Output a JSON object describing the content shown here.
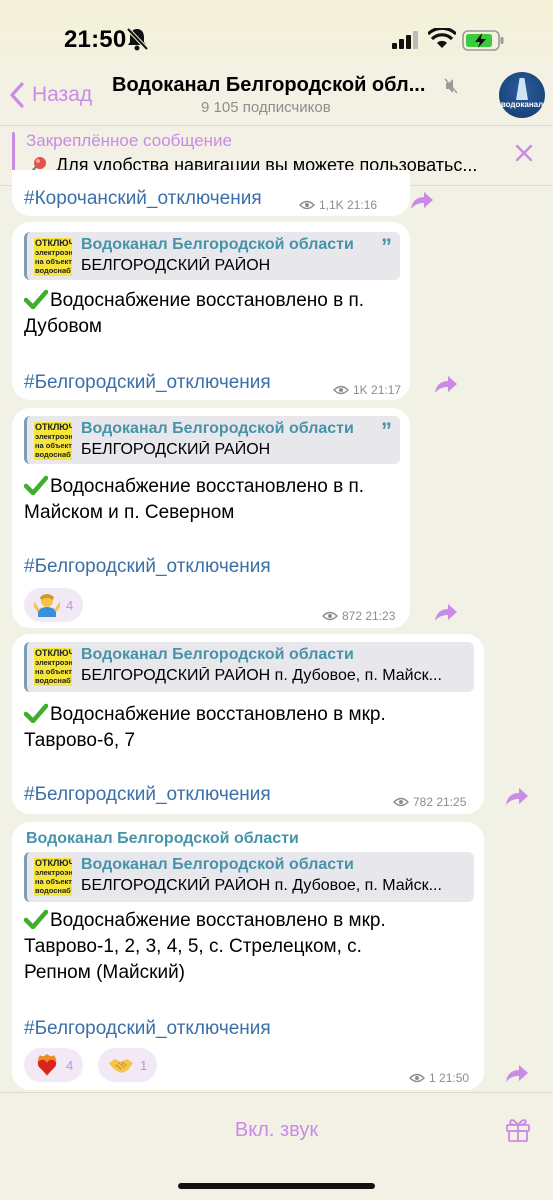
{
  "status_bar": {
    "time": "21:50"
  },
  "header": {
    "back_label": "Назад",
    "title": "Водоканал Белгородской обл...",
    "subscribers": "9 105 подписчиков",
    "avatar_caption": "водоканал"
  },
  "pinned": {
    "title": "Закреплённое сообщение",
    "text": "Для удобства навигации вы можете пользоватьс..."
  },
  "reply_thumb_lines": [
    "ОТКЛЮЧ",
    "электроэн",
    "на объект",
    "водоснаб"
  ],
  "messages": [
    {
      "hashtag": "#Корочанский_отключения",
      "views": "1,1K",
      "time": "21:16"
    },
    {
      "reply_name": "Водоканал Белгородской области",
      "reply_text": "БЕЛГОРОДСКИЙ РАЙОН",
      "line1": "Водоснабжение восстановлено в п.",
      "line2": "Дубовом",
      "hashtag": "#Белгородский_отключения",
      "views": "1K",
      "time": "21:17"
    },
    {
      "reply_name": "Водоканал Белгородской области",
      "reply_text": "БЕЛГОРОДСКИЙ РАЙОН",
      "line1": "Водоснабжение восстановлено в п.",
      "line2": "Майском и п. Северном",
      "hashtag": "#Белгородский_отключения",
      "reaction_count": "4",
      "reaction_icon": "shrug-emoji",
      "views": "872",
      "time": "21:23"
    },
    {
      "reply_name": "Водоканал Белгородской области",
      "reply_text": "БЕЛГОРОДСКИЙ РАЙОН п. Дубовое, п. Майск...",
      "line1": "Водоснабжение восстановлено в мкр.",
      "line2": "Таврово-6, 7",
      "hashtag": "#Белгородский_отключения",
      "views": "782",
      "time": "21:25"
    },
    {
      "author": "Водоканал Белгородской области",
      "reply_name": "Водоканал Белгородской области",
      "reply_text": "БЕЛГОРОДСКИЙ РАЙОН п. Дубовое, п. Майск...",
      "line1": "Водоснабжение восстановлено в мкр.",
      "line2": "Таврово-1, 2, 3, 4, 5, с. Стрелецком, с.",
      "line3": "Репном (Майский)",
      "hashtag": "#Белгородский_отключения",
      "reaction1_count": "4",
      "reaction1_icon": "heart-on-fire-emoji",
      "reaction2_count": "1",
      "reaction2_icon": "handshake-emoji",
      "views": "1",
      "time": "21:50"
    }
  ],
  "bottom": {
    "sound_label": "Вкл. звук"
  },
  "colors": {
    "accent": "#c98be6",
    "link": "#3a6fa8",
    "reply_name": "#4793a9",
    "background": "#f2f1e6"
  }
}
